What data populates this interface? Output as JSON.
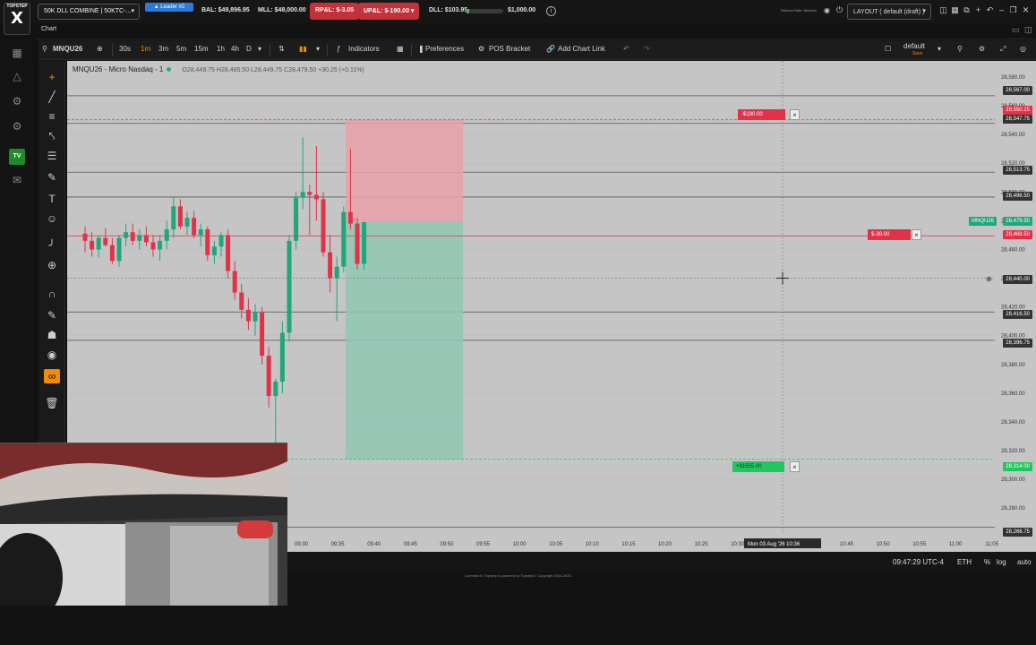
{
  "logo": {
    "text_top": "TOPSTEP",
    "text_big": "X"
  },
  "top_bar": {
    "account": "50K DLL COMBINE | 50KTC-...",
    "leader_badge": "▲ Leader #2",
    "balance": "BAL: $49,896.95",
    "mll": "MLL: $48,000.00",
    "rpl": "RP&L: $-3.05",
    "upl": "UP&L: $-190.00 ▾",
    "dll": "DLL: $103.95",
    "dll_fill_fraction": 0.1,
    "dll_limit": "$1,000.00",
    "risk_label": "Refresh Rate: Medium",
    "layout": "LAYOUT ( default (draft) )"
  },
  "tab": {
    "label": "Chart"
  },
  "chart_toolbar": {
    "symbol": "MNQU26",
    "timeframes": [
      "30s",
      "1m",
      "3m",
      "5m",
      "15m",
      "1h",
      "4h",
      "D"
    ],
    "active_timeframe": "1m",
    "indicators": "Indicators",
    "preferences": "Preferences",
    "pos_bracket": "POS Bracket",
    "add_chart_link": "Add Chart Link",
    "layout_name": "default",
    "layout_sub": "Save"
  },
  "legend": {
    "title": "MNQU26 - Micro Nasdaq - 1",
    "ohlc": "O28,449.75 H28,485.50 L28,449.75 C28,479.50 +30.25 (+0.11%)"
  },
  "price_axis": {
    "ticks": [
      "28,580.00",
      "28,560.00",
      "28,540.00",
      "28,520.00",
      "28,500.00",
      "28,480.00",
      "28,460.00",
      "28,440.00",
      "28,420.00",
      "28,400.00",
      "28,380.00",
      "28,360.00",
      "28,340.00",
      "28,320.00",
      "28,300.00",
      "28,280.00"
    ]
  },
  "price_tags": {
    "line1": "28,567.00",
    "stop_top": "28,550.25",
    "line2": "28,547.75",
    "line3": "28,513.75",
    "line4": "28,496.50",
    "symbol_tag": "MNQU26",
    "last_price": "28,479.50",
    "order_price": "28,469.50",
    "cursor_price": "28,440.00",
    "line5": "28,416.50",
    "line6": "28,396.75",
    "target_price": "28,314.00",
    "line7": "28,266.75"
  },
  "orders": {
    "stop_label": "-$190.00",
    "position_label": "$-30.00",
    "target_label": "+$1555.00"
  },
  "time_axis": {
    "ticks": [
      "09:30",
      "09:35",
      "09:40",
      "09:45",
      "09:50",
      "09:55",
      "10:00",
      "10:05",
      "10:10",
      "10:15",
      "10:20",
      "10:25",
      "10:30",
      "10:35",
      "10:40",
      "10:45",
      "10:50",
      "10:55",
      "11:00",
      "11:05"
    ],
    "crosshair_time": "Mon 03 Aug '26  10:36"
  },
  "status_bar": {
    "clock": "09:47:29 UTC-4",
    "session": "ETH",
    "percent": "%",
    "log": "log",
    "auto": "auto"
  },
  "footer": {
    "license": "Licensed to Topstep & powered by TopstepX. Copyright 2024-2026"
  },
  "colors": {
    "up": "#1fa67a",
    "down": "#e0334a",
    "accent": "#f08c00",
    "chart_bg": "#c5c5c5"
  }
}
